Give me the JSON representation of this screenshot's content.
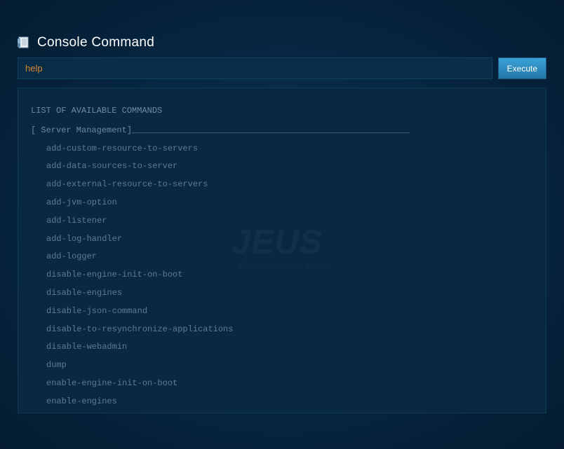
{
  "header": {
    "title": "Console Command"
  },
  "input": {
    "value": "help"
  },
  "button": {
    "execute": "Execute"
  },
  "watermark": {
    "title": "JEUS",
    "subtitle": "Web Application Server"
  },
  "output": {
    "title": "LIST OF AVAILABLE COMMANDS",
    "section": "[ Server Management]_______________________________________________________",
    "commands": [
      "add-custom-resource-to-servers",
      "add-data-sources-to-server",
      "add-external-resource-to-servers",
      "add-jvm-option",
      "add-listener",
      "add-log-handler",
      "add-logger",
      "disable-engine-init-on-boot",
      "disable-engines",
      "disable-json-command",
      "disable-to-resynchronize-applications",
      "disable-webadmin",
      "dump",
      "enable-engine-init-on-boot",
      "enable-engines"
    ]
  }
}
